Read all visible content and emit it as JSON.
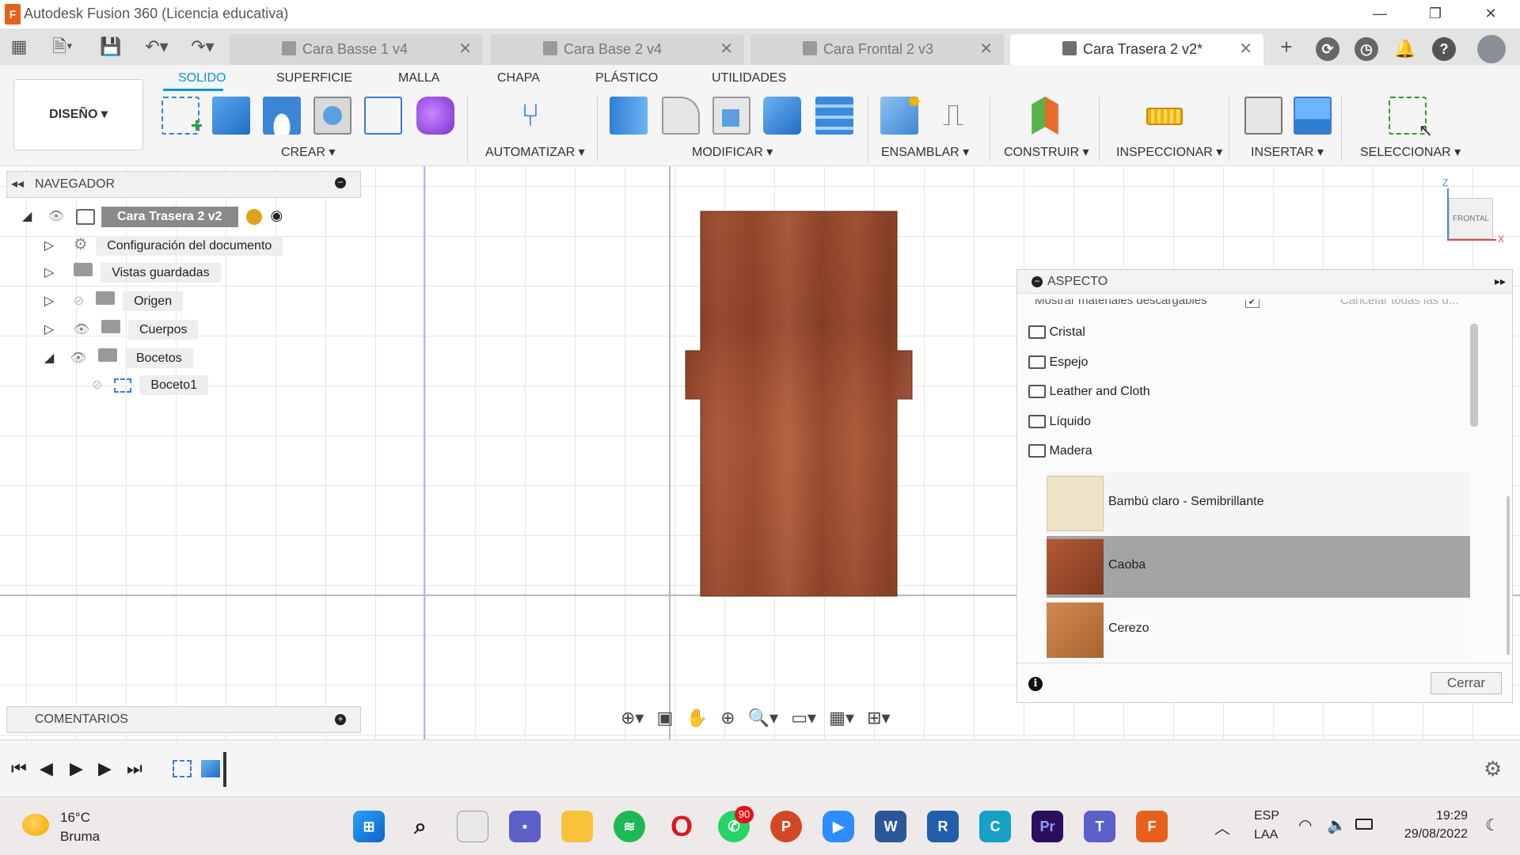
{
  "window": {
    "app_title": "Autodesk Fusion 360 (Licencia educativa)",
    "logo_letter": "F",
    "minimize": "—",
    "restore": "❐",
    "close": "✕"
  },
  "tabs": [
    {
      "label": "Cara Basse 1 v4",
      "active": false
    },
    {
      "label": "Cara Base 2 v4",
      "active": false
    },
    {
      "label": "Cara Frontal 2 v3",
      "active": false
    },
    {
      "label": "Cara Trasera 2 v2*",
      "active": true
    }
  ],
  "tab_close": "✕",
  "ribbon": {
    "workspace": "DISEÑO ▾",
    "tabs": [
      "SOLIDO",
      "SUPERFICIE",
      "MALLA",
      "CHAPA",
      "PLÁSTICO",
      "UTILIDADES"
    ],
    "groups": [
      "CREAR ▾",
      "AUTOMATIZAR ▾",
      "MODIFICAR ▾",
      "ENSAMBLAR ▾",
      "CONSTRUIR ▾",
      "INSPECCIONAR ▾",
      "INSERTAR ▾",
      "SELECCIONAR ▾"
    ]
  },
  "navigator": {
    "title": "NAVEGADOR",
    "root": "Cara Trasera 2 v2",
    "items": [
      {
        "label": "Configuración del documento"
      },
      {
        "label": "Vistas guardadas"
      },
      {
        "label": "Origen"
      },
      {
        "label": "Cuerpos"
      },
      {
        "label": "Bocetos"
      },
      {
        "label": "Boceto1"
      }
    ]
  },
  "comments": {
    "title": "COMENTARIOS"
  },
  "viewcube": {
    "face": "FRONTAL",
    "z": "Z",
    "x": "X"
  },
  "aspecto": {
    "title": "ASPECTO",
    "show_downloadable": "Mostrar materiales descargables",
    "cancel_all": "Cancelar todas las d...",
    "folders": [
      "Cristal",
      "Espejo",
      "Leather and Cloth",
      "Líquido",
      "Madera"
    ],
    "materials": [
      {
        "label": "Bambú claro - Semibrillante",
        "color": "#ede4c8",
        "selected": false
      },
      {
        "label": "Caoba",
        "color": "#9a4a2c",
        "selected": true
      },
      {
        "label": "Cerezo",
        "color": "#c07a45",
        "selected": false
      }
    ],
    "close_button": "Cerrar",
    "info_icon": "i"
  },
  "taskbar": {
    "weather_temp": "16°C",
    "weather_desc": "Bruma",
    "whatsapp_badge": "90",
    "lang_top": "ESP",
    "lang_bottom": "LAA",
    "time": "19:29",
    "date": "29/08/2022"
  },
  "colors": {
    "accent": "#0696d7",
    "fusion_orange": "#e8611a",
    "wood": "#9c4f2e"
  }
}
